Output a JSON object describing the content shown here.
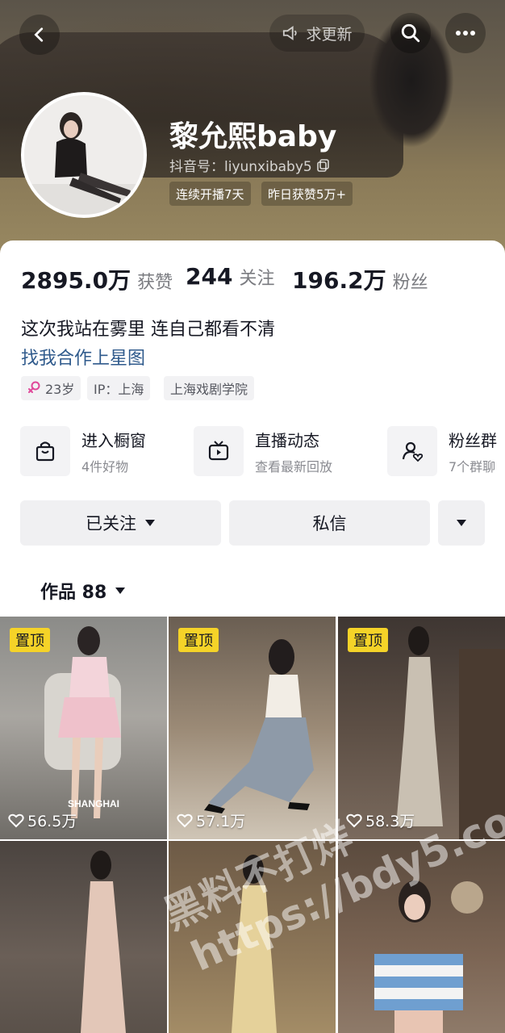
{
  "header": {
    "ask_update": "求更新",
    "name": "黎允熙baby",
    "douyin_id": "抖音号：liyunxibaby5",
    "tags": [
      "连续开播7天",
      "昨日获赞5万+"
    ]
  },
  "stats": [
    {
      "num": "2895.0万",
      "label": "获赞"
    },
    {
      "num": "244",
      "label": "关注"
    },
    {
      "num": "196.2万",
      "label": "粉丝"
    }
  ],
  "bio": "这次我站在雾里 连自己都看不清",
  "link": "找我合作上星图",
  "chips": {
    "age": "23岁",
    "ip": "IP：上海",
    "school": "上海戏剧学院"
  },
  "services": [
    {
      "title": "进入橱窗",
      "sub": "4件好物"
    },
    {
      "title": "直播动态",
      "sub": "查看最新回放"
    },
    {
      "title": "粉丝群",
      "sub": "7个群聊"
    }
  ],
  "buttons": {
    "follow": "已关注",
    "message": "私信"
  },
  "works_tab": "作品 88",
  "works": [
    {
      "pinned": "置顶",
      "likes": "56.5万",
      "overlay": "SHANGHAI"
    },
    {
      "pinned": "置顶",
      "likes": "57.1万"
    },
    {
      "pinned": "置顶",
      "likes": "58.3万"
    },
    {},
    {},
    {}
  ],
  "watermark": [
    "黑料不打烊",
    "https://bdy5.co"
  ],
  "colors": {
    "pin": "#f5d328",
    "link": "#2f5a8c",
    "header": "#7a6c52"
  }
}
